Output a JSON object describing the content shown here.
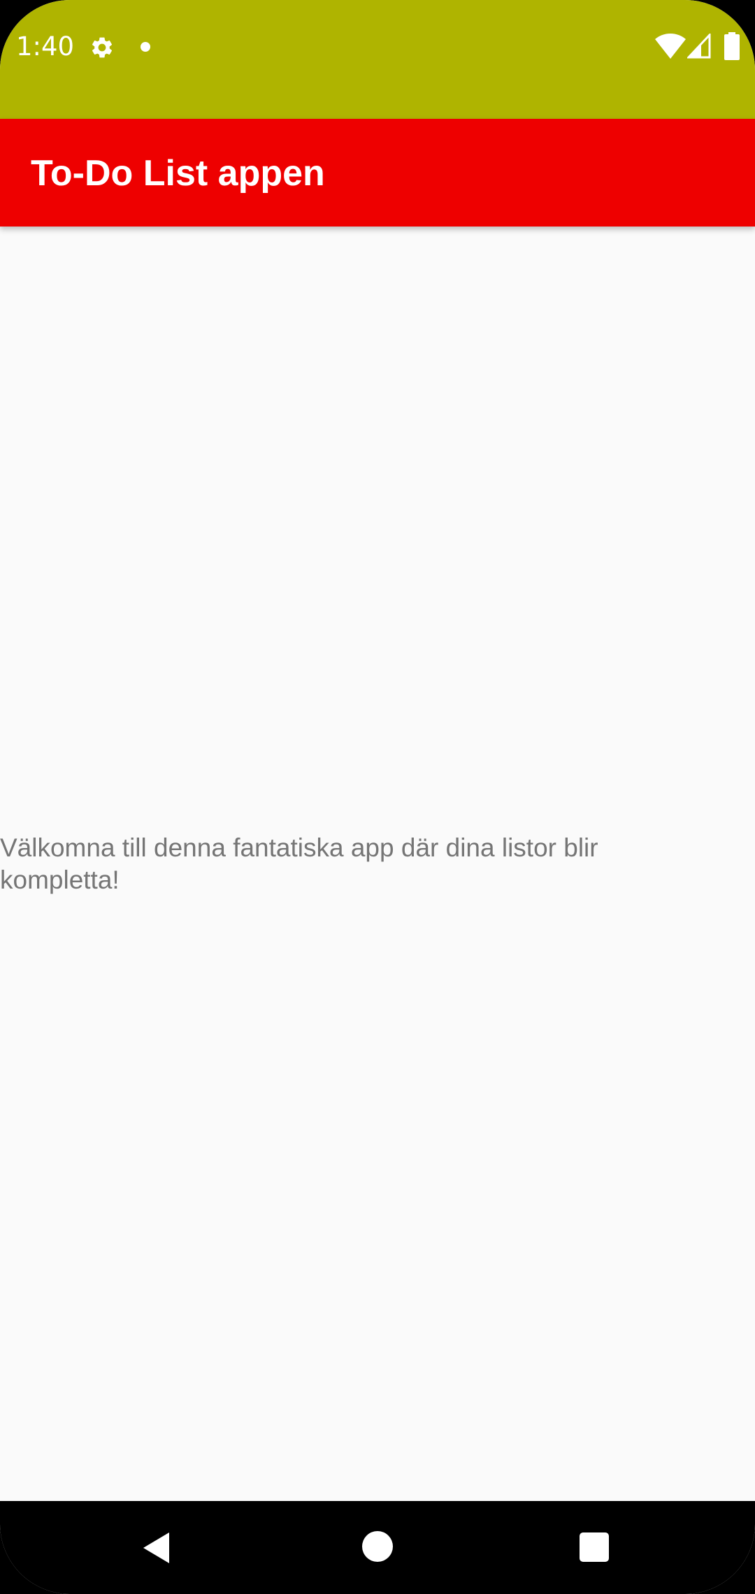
{
  "status_bar": {
    "time": "1:40",
    "background_color": "#afb400",
    "icons": [
      "settings-icon",
      "notification-dot-icon",
      "wifi-icon",
      "cell-signal-icon",
      "battery-icon"
    ]
  },
  "app_bar": {
    "title": "To-Do List appen",
    "background_color": "#ee0000"
  },
  "main": {
    "welcome_text": "Välkomna till denna fantatiska app där dina listor blir kompletta!"
  },
  "nav_bar": {
    "icons": [
      "back-icon",
      "home-icon",
      "recents-icon"
    ]
  }
}
